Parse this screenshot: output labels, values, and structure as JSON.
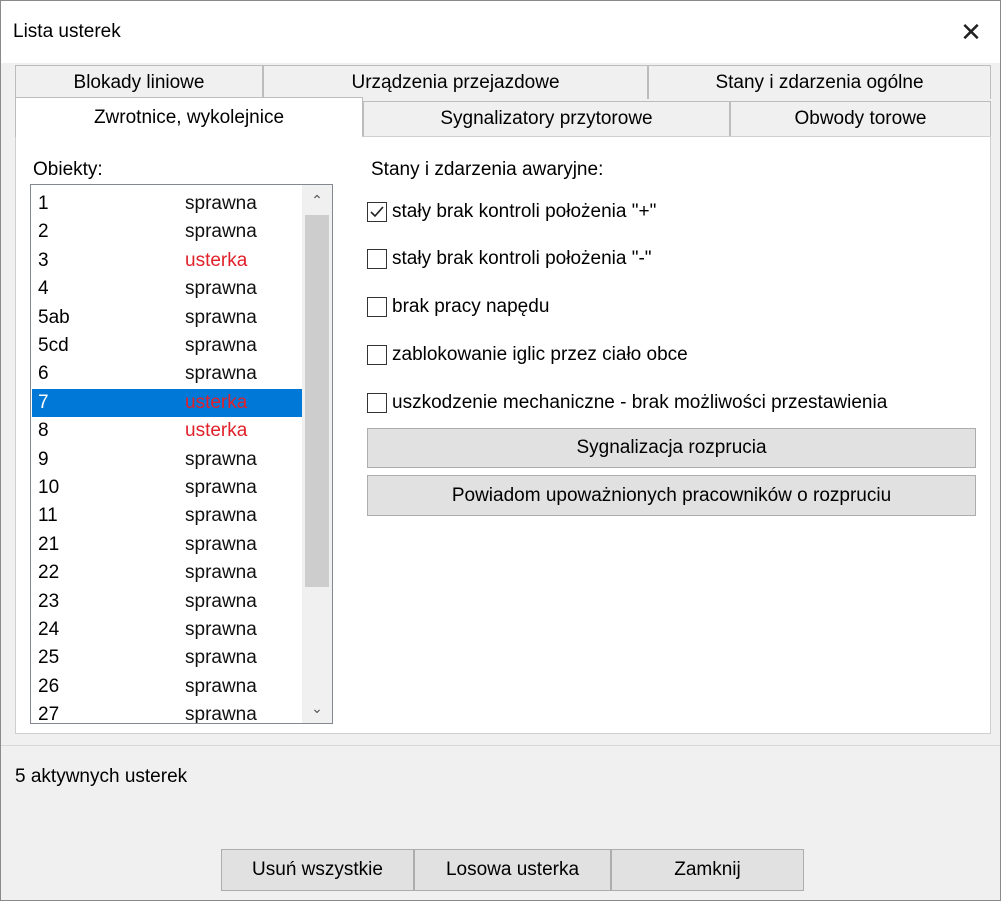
{
  "window": {
    "title": "Lista usterek"
  },
  "tabs": {
    "row1": [
      "Blokady liniowe",
      "Urządzenia przejazdowe",
      "Stany i zdarzenia ogólne"
    ],
    "row2": [
      "Zwrotnice, wykolejnice",
      "Sygnalizatory przytorowe",
      "Obwody torowe"
    ],
    "active": "Zwrotnice, wykolejnice"
  },
  "objects": {
    "label": "Obiekty:",
    "items": [
      {
        "name": "1",
        "status": "sprawna"
      },
      {
        "name": "2",
        "status": "sprawna"
      },
      {
        "name": "3",
        "status": "usterka"
      },
      {
        "name": "4",
        "status": "sprawna"
      },
      {
        "name": "5ab",
        "status": "sprawna"
      },
      {
        "name": "5cd",
        "status": "sprawna"
      },
      {
        "name": "6",
        "status": "sprawna"
      },
      {
        "name": "7",
        "status": "usterka",
        "selected": true
      },
      {
        "name": "8",
        "status": "usterka"
      },
      {
        "name": "9",
        "status": "sprawna"
      },
      {
        "name": "10",
        "status": "sprawna"
      },
      {
        "name": "11",
        "status": "sprawna"
      },
      {
        "name": "21",
        "status": "sprawna"
      },
      {
        "name": "22",
        "status": "sprawna"
      },
      {
        "name": "23",
        "status": "sprawna"
      },
      {
        "name": "24",
        "status": "sprawna"
      },
      {
        "name": "25",
        "status": "sprawna"
      },
      {
        "name": "26",
        "status": "sprawna"
      },
      {
        "name": "27",
        "status": "sprawna"
      }
    ]
  },
  "states": {
    "label": "Stany i zdarzenia awaryjne:",
    "checkboxes": [
      {
        "label": "stały brak kontroli położenia \"+\"",
        "checked": true
      },
      {
        "label": "stały brak kontroli położenia \"-\"",
        "checked": false
      },
      {
        "label": "brak pracy napędu",
        "checked": false
      },
      {
        "label": "zablokowanie iglic przez ciało obce",
        "checked": false
      },
      {
        "label": "uszkodzenie mechaniczne - brak możliwości przestawienia",
        "checked": false
      }
    ],
    "btn_signal": "Sygnalizacja rozprucia",
    "btn_notify": "Powiadom upoważnionych pracowników o rozpruciu"
  },
  "status": {
    "text": "5 aktywnych usterek"
  },
  "footer": {
    "remove_all": "Usuń wszystkie",
    "random": "Losowa usterka",
    "close": "Zamknij"
  },
  "colors": {
    "fault": "#e0202a",
    "selection": "#0078d7"
  }
}
